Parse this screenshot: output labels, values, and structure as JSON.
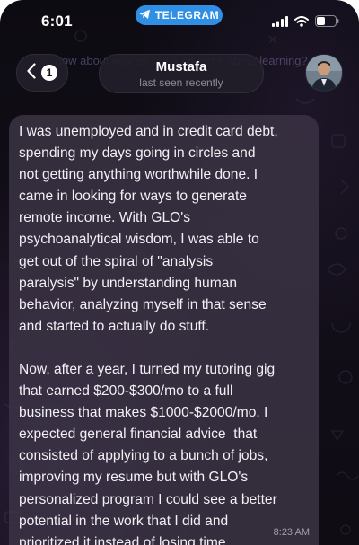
{
  "status_bar": {
    "time": "6:01",
    "app_pill_label": "TELEGRAM",
    "battery_level": 0.45
  },
  "header": {
    "back_badge_count": "1",
    "contact_name": "Mustafa",
    "contact_status": "last seen recently"
  },
  "background_text": "ly, how about you tell me a bit more about learning?",
  "message": {
    "paragraphs": [
      "I was unemployed and in credit card debt,\nspending my days going in circles and\nnot getting anything worthwhile done. I\ncame in looking for ways to generate\nremote income. With GLO's\npsychoanalytical wisdom, I was able to\nget out of the spiral of \"analysis\nparalysis\" by understanding human\nbehavior, analyzing myself in that sense\nand started to actually do stuff.",
      "Now, after a year, I turned my tutoring gig\nthat earned $200-$300/mo to a full\nbusiness that makes $1000-$2000/mo. I\nexpected general financial advice  that\nconsisted of applying to a bunch of jobs,\nimproving my resume but with GLO's\npersonalized program I could see a better\npotential in the work that I did and\nprioritized it instead of losing time."
    ],
    "time": "8:23 AM"
  },
  "colors": {
    "telegram_blue": "#2f8fe4",
    "bubble": "#3c3446",
    "background": "#0f0c14"
  },
  "icons": [
    "telegram-plane-icon",
    "signal-bars-icon",
    "wifi-icon",
    "battery-icon",
    "chevron-left-icon"
  ]
}
